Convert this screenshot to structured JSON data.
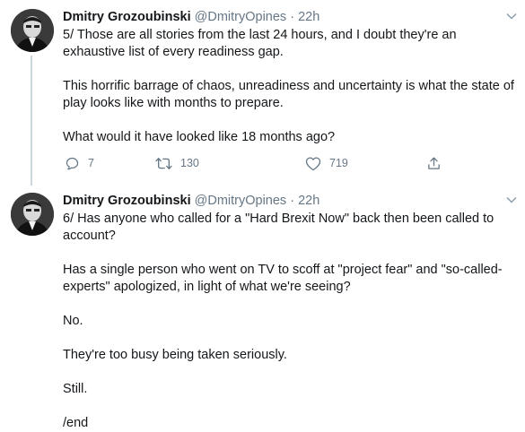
{
  "tweets": [
    {
      "author_name": "Dmitry Grozoubinski",
      "author_handle": "@DmitryOpines",
      "separator": "·",
      "time": "22h",
      "paragraphs": [
        "5/ Those are all stories from the last 24 hours, and I doubt they're an exhaustive list of every readiness gap.",
        "This horrific barrage of chaos, unreadiness and uncertainty is what the state of play looks like with months to prepare.",
        "What would it have looked like 18 months ago?"
      ],
      "reply_count": "7",
      "retweet_count": "130",
      "like_count": "719"
    },
    {
      "author_name": "Dmitry Grozoubinski",
      "author_handle": "@DmitryOpines",
      "separator": "·",
      "time": "22h",
      "paragraphs": [
        "6/ Has anyone who called for a \"Hard Brexit Now\" back then been called to account?",
        "Has a single person who went on TV to scoff at \"project fear\" and \"so-called-experts\" apologized, in light of what we're seeing?",
        "No.",
        "They're too busy being taken seriously.",
        "Still.",
        "/end"
      ]
    }
  ],
  "icons": {
    "reply": "reply-icon",
    "retweet": "retweet-icon",
    "like": "like-icon",
    "share": "share-icon",
    "caret": "chevron-down-icon"
  },
  "colors": {
    "text": "#14171a",
    "secondary": "#657786",
    "thread_line": "#ccd6dd"
  }
}
